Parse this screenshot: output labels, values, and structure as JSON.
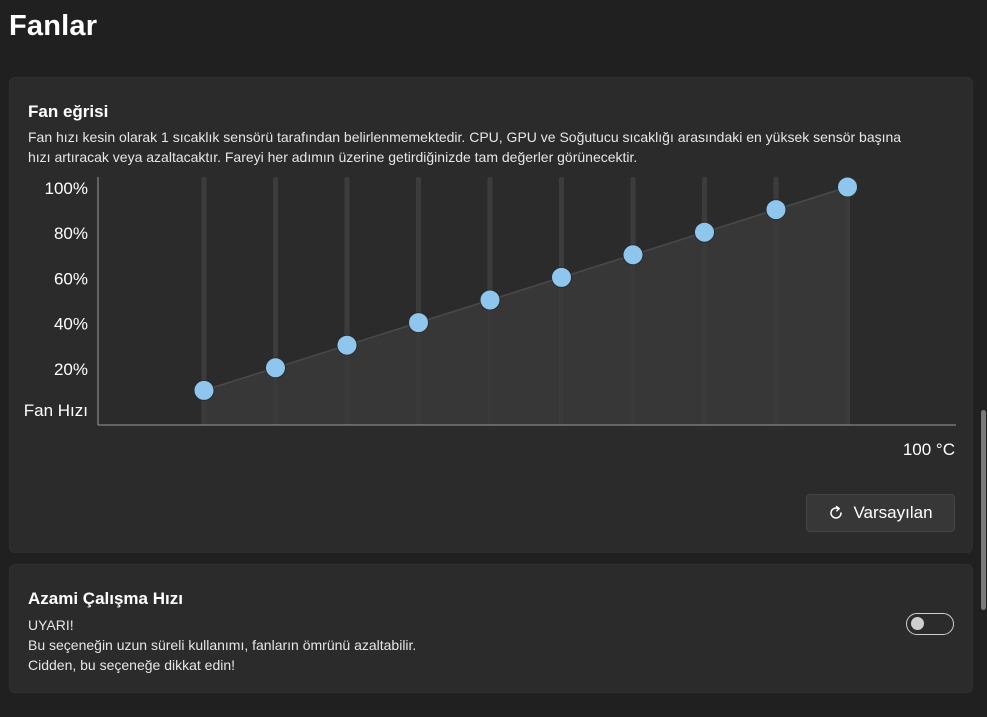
{
  "page": {
    "title": "Fanlar"
  },
  "fan_curve": {
    "title": "Fan eğrisi",
    "description_line1": "Fan hızı kesin olarak 1 sıcaklık sensörü tarafından belirlenmemektedir. CPU, GPU ve Soğutucu sıcaklığı arasındaki en yüksek sensör başına",
    "description_line2": "hızı artıracak veya azaltacaktır. Fareyi her adımın üzerine getirdiğinizde tam değerler görünecektir.",
    "reset_label": "Varsayılan",
    "reset_icon": "refresh-icon"
  },
  "max_speed": {
    "title": "Azami Çalışma Hızı",
    "warning_line1": "UYARI!",
    "warning_line2": "Bu seçeneğin uzun süreli kullanımı, fanların ömrünü azaltabilir.",
    "warning_line3": "Cidden, bu seçeneğe dikkat edin!",
    "toggle_on": false
  },
  "chart_data": {
    "type": "line",
    "ylabel": "Fan Hızı",
    "xlabel": "100 °C",
    "y_ticks": [
      "100%",
      "80%",
      "60%",
      "40%",
      "20%"
    ],
    "ylim": [
      0,
      100
    ],
    "steps": 10,
    "values": [
      10,
      20,
      30,
      40,
      50,
      60,
      70,
      80,
      90,
      100
    ],
    "point_color": "#8ec6ee",
    "fill_color": "#3a3a3a"
  }
}
